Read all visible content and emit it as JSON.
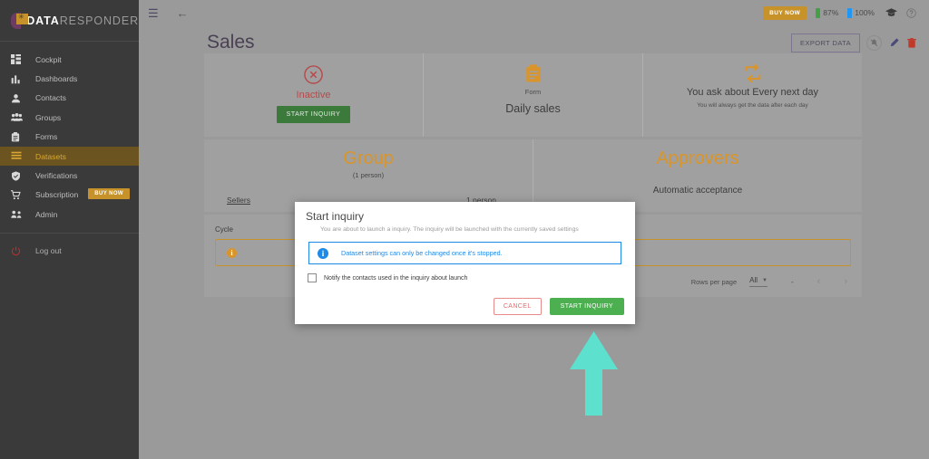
{
  "sidebar": {
    "brand": {
      "bold": "DATA",
      "light": "RESPONDER",
      "icon": "logo-icon"
    },
    "items": [
      {
        "label": "Cockpit",
        "icon": "dashboard-grid-icon",
        "active": false
      },
      {
        "label": "Dashboards",
        "icon": "bar-chart-icon",
        "active": false
      },
      {
        "label": "Contacts",
        "icon": "person-icon",
        "active": false
      },
      {
        "label": "Groups",
        "icon": "people-group-icon",
        "active": false
      },
      {
        "label": "Forms",
        "icon": "clipboard-icon",
        "active": false
      },
      {
        "label": "Datasets",
        "icon": "list-lines-icon",
        "active": true
      },
      {
        "label": "Verifications",
        "icon": "shield-check-icon",
        "active": false
      },
      {
        "label": "Subscription",
        "icon": "cart-icon",
        "active": false,
        "badge": "BUY NOW"
      },
      {
        "label": "Admin",
        "icon": "admin-people-icon",
        "active": false
      }
    ],
    "logout": {
      "label": "Log out",
      "icon": "power-icon"
    }
  },
  "topbar": {
    "menu_icon": "hamburger-icon",
    "back_icon": "arrow-left-icon",
    "buy_now": "BUY NOW",
    "battery_green": "87%",
    "battery_blue": "100%",
    "graduation_icon": "graduation-cap-icon",
    "help_icon": "help-circle-icon"
  },
  "page": {
    "title": "Sales",
    "export_button": "EXPORT DATA",
    "mute_icon": "bell-off-icon",
    "edit_icon": "pencil-icon",
    "delete_icon": "trash-icon"
  },
  "cards": {
    "status": {
      "icon": "circle-x-icon",
      "label": "Inactive",
      "button": "START INQUIRY"
    },
    "form": {
      "icon": "clipboard-icon",
      "sub": "Form",
      "name": "Daily sales"
    },
    "cycle": {
      "icon": "repeat-icon",
      "title": "You ask about Every next day",
      "note": "You will always get the data after each day"
    }
  },
  "group_section": {
    "group": {
      "title": "Group",
      "subtitle": "(1 person)",
      "row_name": "Sellers",
      "row_count": "1 person"
    },
    "approvers": {
      "title": "Approvers",
      "subtitle": "Automatic acceptance"
    }
  },
  "cycle_block": {
    "label": "Cycle",
    "info_icon": "info-icon"
  },
  "footer": {
    "rows_per_page_label": "Rows per page",
    "rows_per_page_value": "All",
    "range": "-",
    "prev_icon": "chevron-left-icon",
    "next_icon": "chevron-right-icon"
  },
  "modal": {
    "title": "Start inquiry",
    "description": "You are about to launch a inquiry. The inquiry will be launched with the currently saved settings",
    "info_icon": "info-icon",
    "info_text": "Dataset settings can only be changed once it's stopped.",
    "checkbox_label": "Notify the contacts used in the inquiry about launch",
    "checkbox_checked": false,
    "cancel_button": "CANCEL",
    "confirm_button": "START INQUIRY"
  },
  "annotation": {
    "arrow": "up-arrow-annotation",
    "color": "#5ee0cf"
  },
  "colors": {
    "brand_gold": "#c8922a",
    "sidebar_bg": "#3a3a3a",
    "accent_green": "#4caf50",
    "info_blue": "#1e8ae5",
    "danger_red": "#c0392b",
    "arrow_teal": "#5ee0cf"
  }
}
